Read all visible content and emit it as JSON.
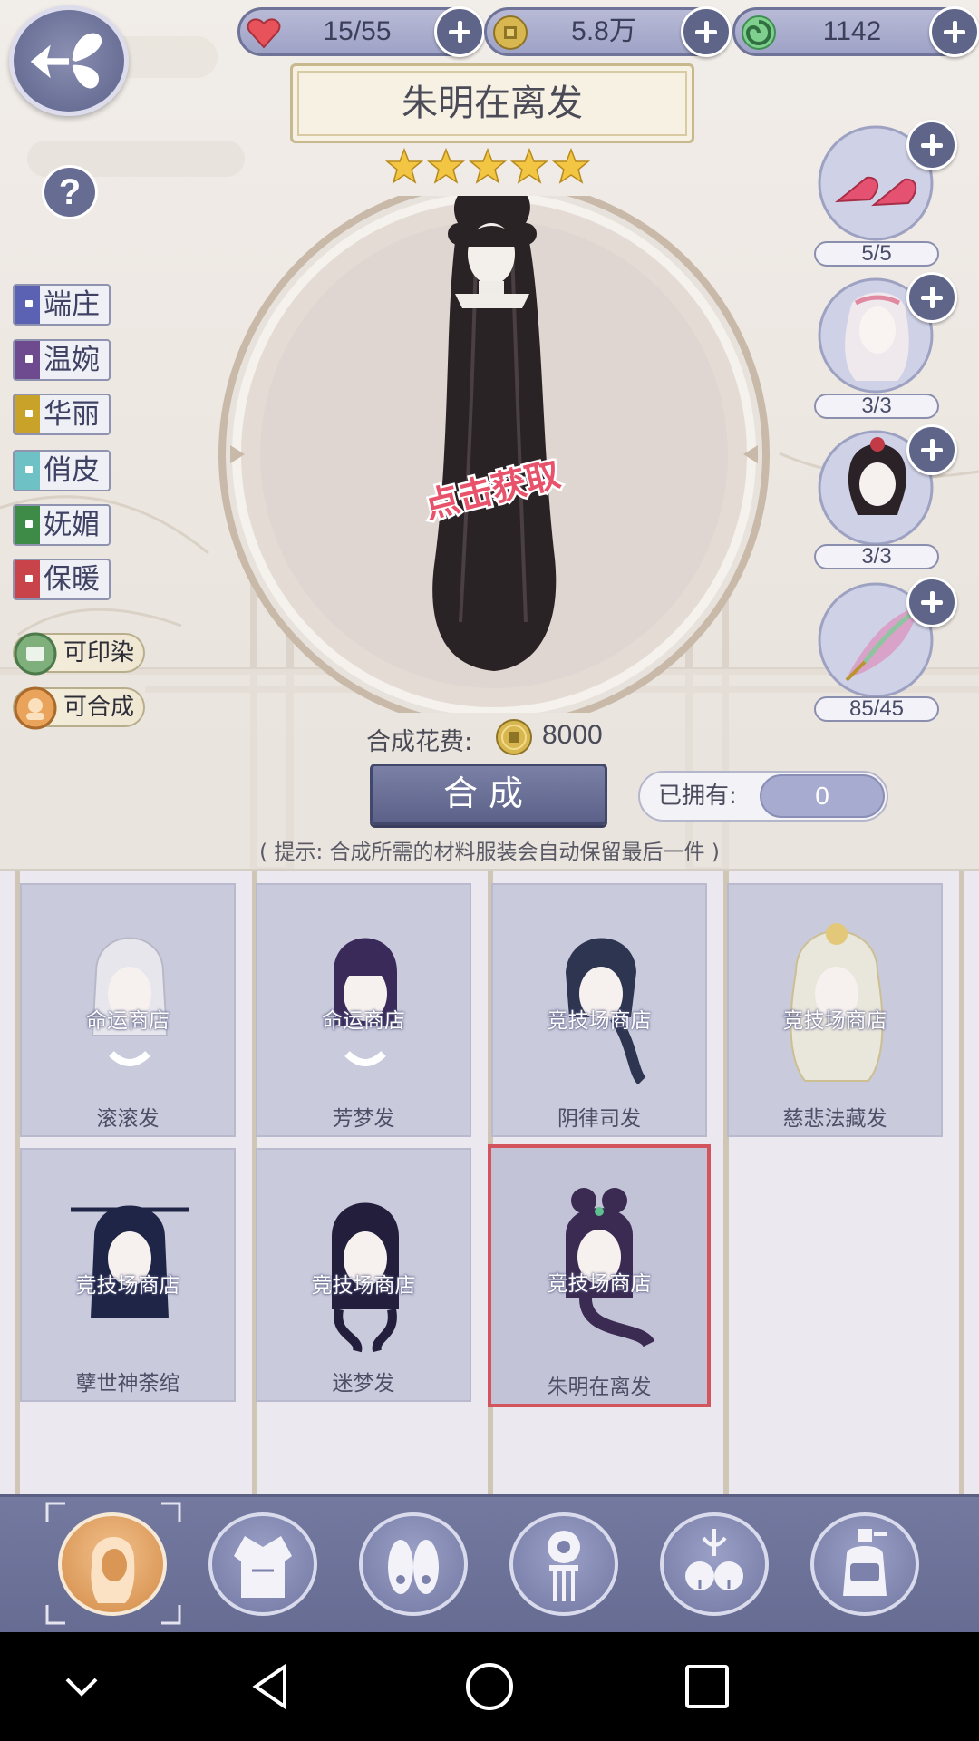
{
  "resources": {
    "stamina": {
      "value": "15/55",
      "icon": "heart-icon"
    },
    "coins": {
      "value": "5.8万",
      "icon": "coin-icon"
    },
    "jade": {
      "value": "1142",
      "icon": "jade-swirl-icon"
    }
  },
  "title": "朱明在离发",
  "stars": 5,
  "styles": [
    {
      "label": "端庄",
      "color": "#5b62b4"
    },
    {
      "label": "温婉",
      "color": "#6e4a8e"
    },
    {
      "label": "华丽",
      "color": "#c9a22a"
    },
    {
      "label": "俏皮",
      "color": "#6ec1c4"
    },
    {
      "label": "妩媚",
      "color": "#3d8b46"
    },
    {
      "label": "保暖",
      "color": "#c8444a"
    }
  ],
  "features": [
    {
      "label": "可印染",
      "icon": "dye-icon"
    },
    {
      "label": "可合成",
      "icon": "synthesize-icon"
    }
  ],
  "preview": {
    "overlay": "点击获取"
  },
  "materials": [
    {
      "icon": "shoes-icon",
      "count": "5/5"
    },
    {
      "icon": "white-hair-icon",
      "count": "3/3"
    },
    {
      "icon": "dark-hair-icon",
      "count": "3/3"
    },
    {
      "icon": "feather-icon",
      "count": "85/45"
    }
  ],
  "cost": {
    "label": "合成花费:",
    "value": "8000"
  },
  "synth_button": "合成",
  "owned": {
    "label": "已拥有:",
    "value": "0"
  },
  "hint": "( 提示: 合成所需的材料服装会自动保留最后一件 )",
  "cards": [
    {
      "name": "滚滚发",
      "source": "命运商店",
      "hair": "#e6e6ec"
    },
    {
      "name": "芳梦发",
      "source": "命运商店",
      "hair": "#3a2a5a"
    },
    {
      "name": "阴律司发",
      "source": "竞技场商店",
      "hair": "#2e3550"
    },
    {
      "name": "慈悲法藏发",
      "source": "竞技场商店",
      "hair": "#e9e6dc"
    },
    {
      "name": "孽世神荼绾",
      "source": "竞技场商店",
      "hair": "#1f2546"
    },
    {
      "name": "迷梦发",
      "source": "竞技场商店",
      "hair": "#221e3c"
    },
    {
      "name": "朱明在离发",
      "source": "竞技场商店",
      "hair": "#3b2a52"
    }
  ],
  "categories": [
    {
      "icon": "hair-category-icon",
      "active": true
    },
    {
      "icon": "dress-category-icon",
      "active": false
    },
    {
      "icon": "shoes-category-icon",
      "active": false
    },
    {
      "icon": "hairpin-category-icon",
      "active": false
    },
    {
      "icon": "bells-accessory-icon",
      "active": false
    },
    {
      "icon": "makeup-jar-icon",
      "active": false
    }
  ]
}
